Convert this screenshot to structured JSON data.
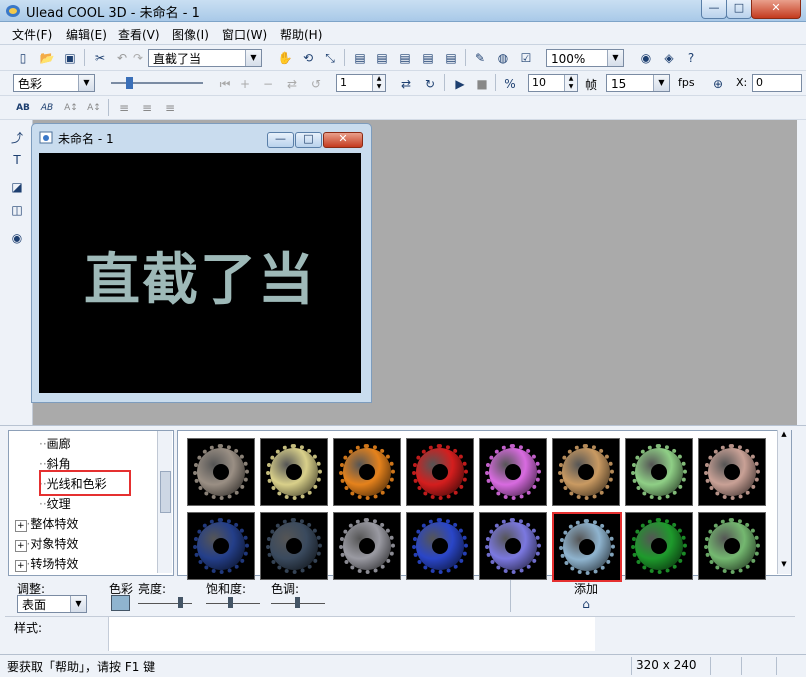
{
  "window": {
    "title": "Ulead COOL 3D - 未命名 - 1",
    "minimize": "—",
    "maximize": "□",
    "close": "✕"
  },
  "menubar": {
    "items": [
      "文件(F)",
      "编辑(E)",
      "查看(V)",
      "图像(I)",
      "窗口(W)",
      "帮助(H)"
    ]
  },
  "toolbar1": {
    "object_select": "直截了当",
    "zoom_select": "100%"
  },
  "toolbar2": {
    "attribute_select": "色彩",
    "frame_value": "1",
    "total_frames": "10",
    "frame_label": "帧",
    "fps_value": "15",
    "fps_label": "fps",
    "x_label": "X:",
    "x_value": "0"
  },
  "child_window": {
    "title": "未命名 - 1",
    "canvas_text": "直截了当"
  },
  "tree": {
    "items": [
      {
        "label": "画廊",
        "level": 2
      },
      {
        "label": "斜角",
        "level": 2
      },
      {
        "label": "光线和色彩",
        "level": 2,
        "highlighted": true
      },
      {
        "label": "纹理",
        "level": 2
      },
      {
        "label": "整体特效",
        "level": 1
      },
      {
        "label": "对象特效",
        "level": 1
      },
      {
        "label": "转场特效",
        "level": 1
      }
    ]
  },
  "thumbnails": {
    "row1": [
      {
        "color": "#9a8f84"
      },
      {
        "color": "#d9d08a"
      },
      {
        "color": "#e5821c"
      },
      {
        "color": "#d41e1e"
      },
      {
        "color": "#d86be0"
      },
      {
        "color": "#c99a62"
      },
      {
        "color": "#8fcf86"
      },
      {
        "color": "#c9a196"
      }
    ],
    "row2": [
      {
        "color": "#243f8a"
      },
      {
        "color": "#3a4a5e"
      },
      {
        "color": "#9a9aa2"
      },
      {
        "color": "#2a46c8"
      },
      {
        "color": "#7b78e0"
      },
      {
        "color": "#8fb4cf",
        "selected": true
      },
      {
        "color": "#1e9a2c"
      },
      {
        "color": "#74b870"
      }
    ]
  },
  "properties": {
    "adjust_label": "调整:",
    "adjust_value": "表面",
    "color_label": "色彩",
    "brightness_label": "亮度:",
    "saturation_label": "饱和度:",
    "hue_label": "色调:",
    "add_label": "添加",
    "style_label": "样式:"
  },
  "statusbar": {
    "help_text": "要获取「帮助」，请按 F1 键",
    "canvas_size": "320 x 240"
  }
}
